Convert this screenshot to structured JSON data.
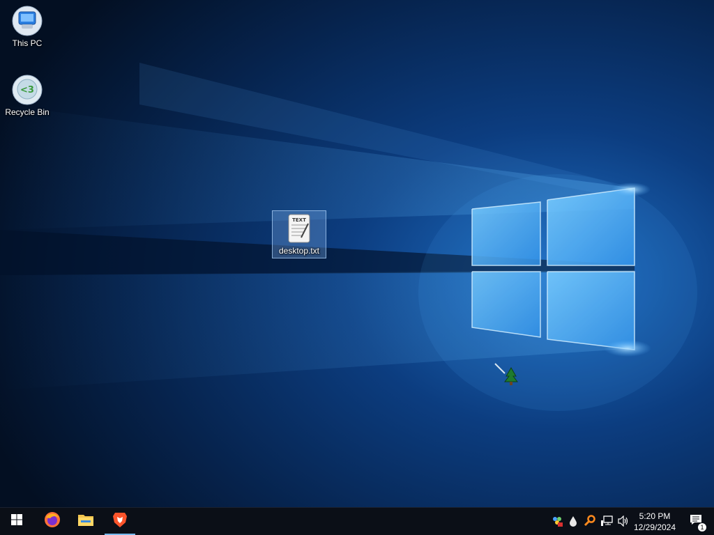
{
  "desktop": {
    "icons": [
      {
        "label": "This PC",
        "icon": "computer-icon"
      },
      {
        "label": "Recycle Bin",
        "icon": "recycle-bin-icon"
      },
      {
        "label": "desktop.txt",
        "icon": "text-file-icon",
        "selected": true
      }
    ],
    "cursor": "tree-cursor-icon"
  },
  "taskbar": {
    "start": "windows-logo-icon",
    "pinned": [
      {
        "name": "firefox",
        "icon": "firefox-icon"
      },
      {
        "name": "file-explorer",
        "icon": "folder-icon"
      },
      {
        "name": "brave",
        "icon": "brave-lion-icon",
        "active": true
      }
    ],
    "tray": [
      "network-tools-icon",
      "droplet-icon",
      "search-key-icon",
      "network-icon",
      "volume-icon"
    ],
    "clock": {
      "time": "5:20 PM",
      "date": "12/29/2024"
    },
    "notifications": {
      "count": "1"
    }
  },
  "colors": {
    "accent": "#76b9ed",
    "taskbar": "#0b0f17",
    "wallpaper_dark": "#03152e",
    "wallpaper_light": "#64c8ff"
  }
}
